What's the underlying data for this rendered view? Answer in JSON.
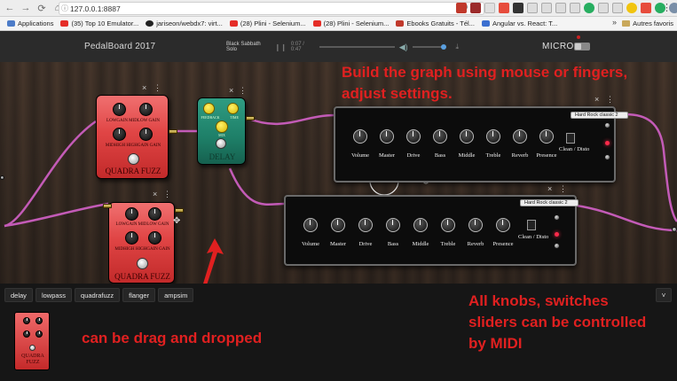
{
  "browser": {
    "url": "127.0.0.1:8887",
    "bookmarks": [
      {
        "label": "Applications",
        "color": "#4d7cc8"
      },
      {
        "label": "(35) Top 10 Emulator...",
        "color": "#e52d27"
      },
      {
        "label": "jariseon/webdx7: virt...",
        "color": "#222222"
      },
      {
        "label": "(28) Plini - Selenium...",
        "color": "#e52d27"
      },
      {
        "label": "(28) Plini - Selenium...",
        "color": "#e52d27"
      },
      {
        "label": "Ebooks Gratuits - Tél...",
        "color": "#c0392b"
      },
      {
        "label": "Angular vs. React: T...",
        "color": "#3b6fd0"
      }
    ],
    "bookmarks_more": "»",
    "bookmarks_folder": "Autres favoris"
  },
  "header": {
    "title": "PedalBoard 2017",
    "song": "Black Sabbath Solo",
    "time": "0:07 / 0:47",
    "micro_label": "MICRO"
  },
  "pedals": {
    "quadrafuzz1": {
      "label_top": "LOWGAIN MIDLOW GAIN",
      "label_bottom": "MIDHIGH HIGHGAIN GAIN",
      "name": "QUADRA FUZZ"
    },
    "delay": {
      "label_feedback": "FEEDBACK",
      "label_time": "TIME",
      "label_mix": "MIX",
      "name": "DELAY"
    },
    "quadrafuzz2": {
      "label_top": "LOWGAIN MIDLOW GAIN",
      "label_bottom": "MIDHIGH HIGHGAIN GAIN",
      "name": "QUADRA FUZZ"
    }
  },
  "amps": [
    {
      "preset": "Hard Rock classic 2",
      "knobs": [
        "Volume",
        "Master",
        "Drive",
        "Bass",
        "Middle",
        "Treble",
        "Reverb",
        "Presence"
      ],
      "switch_label": "Clean / Disto"
    },
    {
      "preset": "Hard Rock classic 2",
      "knobs": [
        "Volume",
        "Master",
        "Drive",
        "Bass",
        "Middle",
        "Treble",
        "Reverb",
        "Presence"
      ],
      "switch_label": "Clean / Disto"
    }
  ],
  "annotations": {
    "build": "Build the graph using mouse or fingers, adjust settings.",
    "drag": "can be drag and dropped",
    "midi": "All knobs, switches sliders can be controlled by MIDI"
  },
  "palette": {
    "tabs": [
      "delay",
      "lowpass",
      "quadrafuzz",
      "flanger",
      "ampsim"
    ],
    "thumb_label": "QUADRA FUZZ",
    "collapse": "˅"
  }
}
